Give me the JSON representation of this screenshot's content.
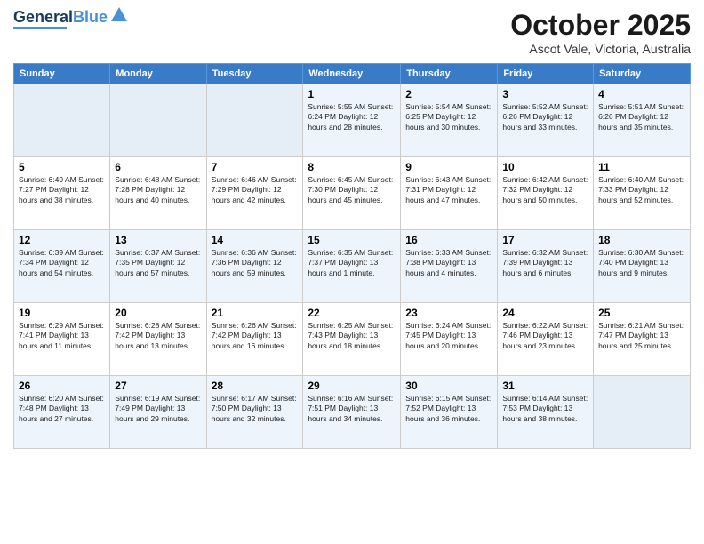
{
  "header": {
    "logo_line1": "General",
    "logo_line2": "Blue",
    "month": "October 2025",
    "location": "Ascot Vale, Victoria, Australia"
  },
  "weekdays": [
    "Sunday",
    "Monday",
    "Tuesday",
    "Wednesday",
    "Thursday",
    "Friday",
    "Saturday"
  ],
  "weeks": [
    [
      {
        "day": "",
        "info": ""
      },
      {
        "day": "",
        "info": ""
      },
      {
        "day": "",
        "info": ""
      },
      {
        "day": "1",
        "info": "Sunrise: 5:55 AM\nSunset: 6:24 PM\nDaylight: 12 hours\nand 28 minutes."
      },
      {
        "day": "2",
        "info": "Sunrise: 5:54 AM\nSunset: 6:25 PM\nDaylight: 12 hours\nand 30 minutes."
      },
      {
        "day": "3",
        "info": "Sunrise: 5:52 AM\nSunset: 6:26 PM\nDaylight: 12 hours\nand 33 minutes."
      },
      {
        "day": "4",
        "info": "Sunrise: 5:51 AM\nSunset: 6:26 PM\nDaylight: 12 hours\nand 35 minutes."
      }
    ],
    [
      {
        "day": "5",
        "info": "Sunrise: 6:49 AM\nSunset: 7:27 PM\nDaylight: 12 hours\nand 38 minutes."
      },
      {
        "day": "6",
        "info": "Sunrise: 6:48 AM\nSunset: 7:28 PM\nDaylight: 12 hours\nand 40 minutes."
      },
      {
        "day": "7",
        "info": "Sunrise: 6:46 AM\nSunset: 7:29 PM\nDaylight: 12 hours\nand 42 minutes."
      },
      {
        "day": "8",
        "info": "Sunrise: 6:45 AM\nSunset: 7:30 PM\nDaylight: 12 hours\nand 45 minutes."
      },
      {
        "day": "9",
        "info": "Sunrise: 6:43 AM\nSunset: 7:31 PM\nDaylight: 12 hours\nand 47 minutes."
      },
      {
        "day": "10",
        "info": "Sunrise: 6:42 AM\nSunset: 7:32 PM\nDaylight: 12 hours\nand 50 minutes."
      },
      {
        "day": "11",
        "info": "Sunrise: 6:40 AM\nSunset: 7:33 PM\nDaylight: 12 hours\nand 52 minutes."
      }
    ],
    [
      {
        "day": "12",
        "info": "Sunrise: 6:39 AM\nSunset: 7:34 PM\nDaylight: 12 hours\nand 54 minutes."
      },
      {
        "day": "13",
        "info": "Sunrise: 6:37 AM\nSunset: 7:35 PM\nDaylight: 12 hours\nand 57 minutes."
      },
      {
        "day": "14",
        "info": "Sunrise: 6:36 AM\nSunset: 7:36 PM\nDaylight: 12 hours\nand 59 minutes."
      },
      {
        "day": "15",
        "info": "Sunrise: 6:35 AM\nSunset: 7:37 PM\nDaylight: 13 hours\nand 1 minute."
      },
      {
        "day": "16",
        "info": "Sunrise: 6:33 AM\nSunset: 7:38 PM\nDaylight: 13 hours\nand 4 minutes."
      },
      {
        "day": "17",
        "info": "Sunrise: 6:32 AM\nSunset: 7:39 PM\nDaylight: 13 hours\nand 6 minutes."
      },
      {
        "day": "18",
        "info": "Sunrise: 6:30 AM\nSunset: 7:40 PM\nDaylight: 13 hours\nand 9 minutes."
      }
    ],
    [
      {
        "day": "19",
        "info": "Sunrise: 6:29 AM\nSunset: 7:41 PM\nDaylight: 13 hours\nand 11 minutes."
      },
      {
        "day": "20",
        "info": "Sunrise: 6:28 AM\nSunset: 7:42 PM\nDaylight: 13 hours\nand 13 minutes."
      },
      {
        "day": "21",
        "info": "Sunrise: 6:26 AM\nSunset: 7:42 PM\nDaylight: 13 hours\nand 16 minutes."
      },
      {
        "day": "22",
        "info": "Sunrise: 6:25 AM\nSunset: 7:43 PM\nDaylight: 13 hours\nand 18 minutes."
      },
      {
        "day": "23",
        "info": "Sunrise: 6:24 AM\nSunset: 7:45 PM\nDaylight: 13 hours\nand 20 minutes."
      },
      {
        "day": "24",
        "info": "Sunrise: 6:22 AM\nSunset: 7:46 PM\nDaylight: 13 hours\nand 23 minutes."
      },
      {
        "day": "25",
        "info": "Sunrise: 6:21 AM\nSunset: 7:47 PM\nDaylight: 13 hours\nand 25 minutes."
      }
    ],
    [
      {
        "day": "26",
        "info": "Sunrise: 6:20 AM\nSunset: 7:48 PM\nDaylight: 13 hours\nand 27 minutes."
      },
      {
        "day": "27",
        "info": "Sunrise: 6:19 AM\nSunset: 7:49 PM\nDaylight: 13 hours\nand 29 minutes."
      },
      {
        "day": "28",
        "info": "Sunrise: 6:17 AM\nSunset: 7:50 PM\nDaylight: 13 hours\nand 32 minutes."
      },
      {
        "day": "29",
        "info": "Sunrise: 6:16 AM\nSunset: 7:51 PM\nDaylight: 13 hours\nand 34 minutes."
      },
      {
        "day": "30",
        "info": "Sunrise: 6:15 AM\nSunset: 7:52 PM\nDaylight: 13 hours\nand 36 minutes."
      },
      {
        "day": "31",
        "info": "Sunrise: 6:14 AM\nSunset: 7:53 PM\nDaylight: 13 hours\nand 38 minutes."
      },
      {
        "day": "",
        "info": ""
      }
    ]
  ]
}
